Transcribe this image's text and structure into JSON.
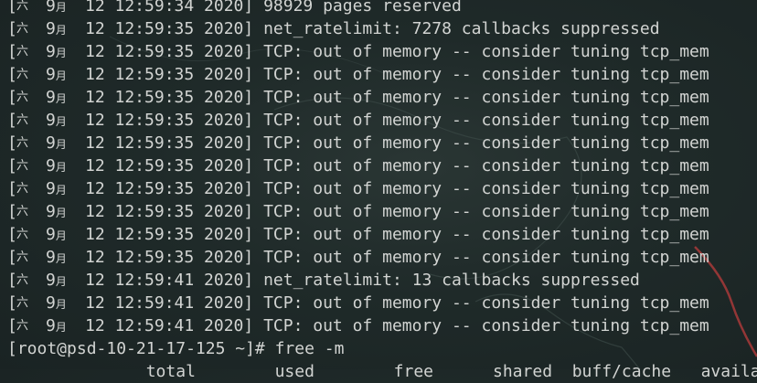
{
  "terminal": {
    "log_lines": [
      {
        "day": "六",
        "month_num": "9",
        "month_char": "月",
        "rest": "12 12:59:34 2020] 98929 pages reserved"
      },
      {
        "day": "六",
        "month_num": "9",
        "month_char": "月",
        "rest": "12 12:59:35 2020] net_ratelimit: 7278 callbacks suppressed"
      },
      {
        "day": "六",
        "month_num": "9",
        "month_char": "月",
        "rest": "12 12:59:35 2020] TCP: out of memory -- consider tuning tcp_mem"
      },
      {
        "day": "六",
        "month_num": "9",
        "month_char": "月",
        "rest": "12 12:59:35 2020] TCP: out of memory -- consider tuning tcp_mem"
      },
      {
        "day": "六",
        "month_num": "9",
        "month_char": "月",
        "rest": "12 12:59:35 2020] TCP: out of memory -- consider tuning tcp_mem"
      },
      {
        "day": "六",
        "month_num": "9",
        "month_char": "月",
        "rest": "12 12:59:35 2020] TCP: out of memory -- consider tuning tcp_mem"
      },
      {
        "day": "六",
        "month_num": "9",
        "month_char": "月",
        "rest": "12 12:59:35 2020] TCP: out of memory -- consider tuning tcp_mem"
      },
      {
        "day": "六",
        "month_num": "9",
        "month_char": "月",
        "rest": "12 12:59:35 2020] TCP: out of memory -- consider tuning tcp_mem"
      },
      {
        "day": "六",
        "month_num": "9",
        "month_char": "月",
        "rest": "12 12:59:35 2020] TCP: out of memory -- consider tuning tcp_mem"
      },
      {
        "day": "六",
        "month_num": "9",
        "month_char": "月",
        "rest": "12 12:59:35 2020] TCP: out of memory -- consider tuning tcp_mem"
      },
      {
        "day": "六",
        "month_num": "9",
        "month_char": "月",
        "rest": "12 12:59:35 2020] TCP: out of memory -- consider tuning tcp_mem"
      },
      {
        "day": "六",
        "month_num": "9",
        "month_char": "月",
        "rest": "12 12:59:35 2020] TCP: out of memory -- consider tuning tcp_mem"
      },
      {
        "day": "六",
        "month_num": "9",
        "month_char": "月",
        "rest": "12 12:59:41 2020] net_ratelimit: 13 callbacks suppressed"
      },
      {
        "day": "六",
        "month_num": "9",
        "month_char": "月",
        "rest": "12 12:59:41 2020] TCP: out of memory -- consider tuning tcp_mem"
      },
      {
        "day": "六",
        "month_num": "9",
        "month_char": "月",
        "rest": "12 12:59:41 2020] TCP: out of memory -- consider tuning tcp_mem"
      }
    ],
    "prompt": "[root@psd-10-21-17-125 ~]# free -m",
    "free_header": "              total        used        free      shared  buff/cache   available"
  },
  "colors": {
    "text": "#d2d4d2",
    "background": "#1f2a29",
    "accent_line": "#a83a3a"
  }
}
